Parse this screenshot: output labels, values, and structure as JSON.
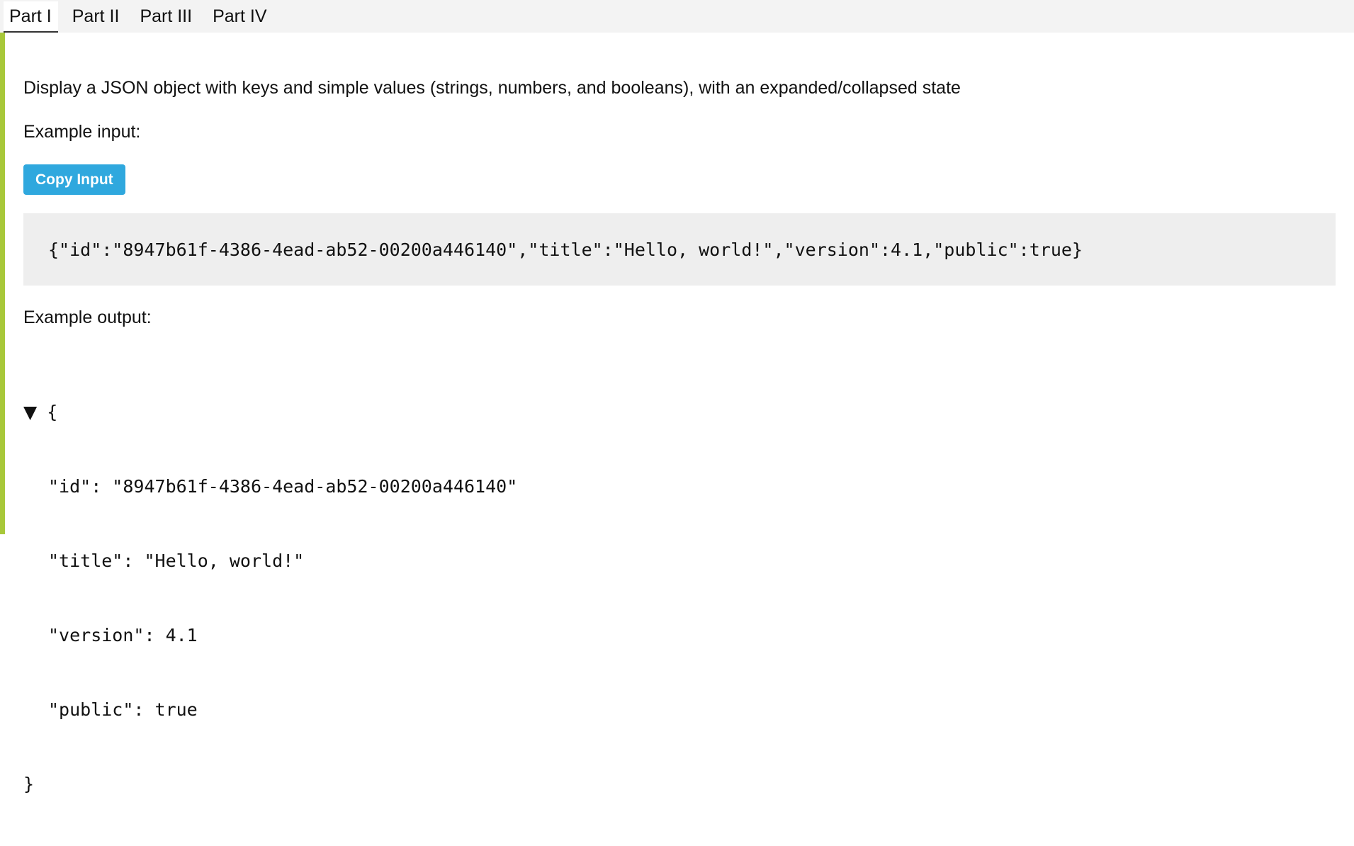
{
  "tabs": [
    {
      "label": "Part I",
      "active": true
    },
    {
      "label": "Part II",
      "active": false
    },
    {
      "label": "Part III",
      "active": false
    },
    {
      "label": "Part IV",
      "active": false
    }
  ],
  "description": "Display a JSON object with keys and simple values (strings, numbers, and booleans), with an expanded/collapsed state",
  "example_input_label": "Example input:",
  "copy_button_label": "Copy Input",
  "input_code": "{\"id\":\"8947b61f-4386-4ead-ab52-00200a446140\",\"title\":\"Hello, world!\",\"version\":4.1,\"public\":true}",
  "example_output_label": "Example output:",
  "tree": {
    "toggle_glyph": "▼",
    "open_brace": "{",
    "close_brace": "}",
    "entries": [
      "\"id\": \"8947b61f-4386-4ead-ab52-00200a446140\"",
      "\"title\": \"Hello, world!\"",
      "\"version\": 4.1",
      "\"public\": true"
    ]
  },
  "colors": {
    "accent_rule": "#a8c83a",
    "button": "#2fa8de",
    "tab_bar": "#f3f3f3",
    "code_bg": "#eeeeee"
  }
}
